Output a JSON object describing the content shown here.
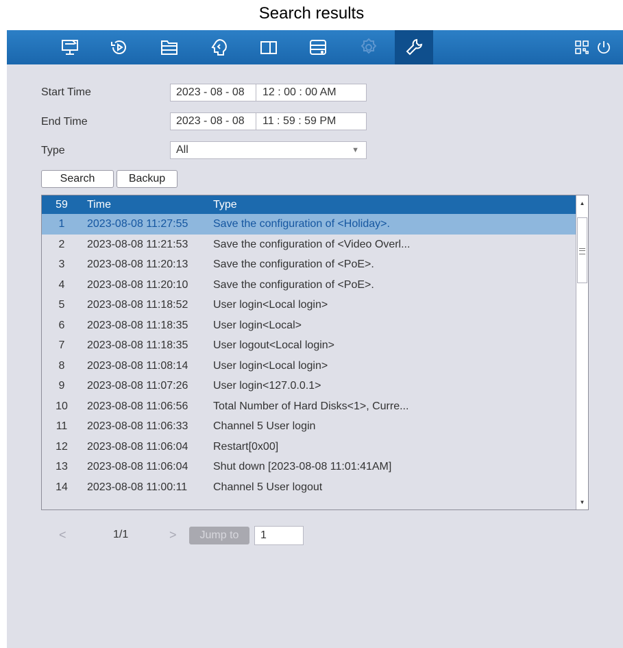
{
  "caption": "Search results",
  "nav": {
    "icons": [
      "live-view",
      "playback",
      "file-management",
      "smart-analytics",
      "camera",
      "storage",
      "settings",
      "maintenance"
    ],
    "active": "maintenance",
    "right_icons": [
      "qr-code",
      "power"
    ]
  },
  "form": {
    "start_time_label": "Start Time",
    "start_date": "2023 - 08 - 08",
    "start_time": "12 : 00 : 00  AM",
    "end_time_label": "End Time",
    "end_date": "2023 - 08 - 08",
    "end_time": "11 : 59 : 59  PM",
    "type_label": "Type",
    "type_value": "All"
  },
  "buttons": {
    "search": "Search",
    "backup": "Backup"
  },
  "table": {
    "count": "59",
    "col_time": "Time",
    "col_type": "Type",
    "rows": [
      {
        "n": "1",
        "time": "2023-08-08 11:27:55",
        "type": "Save the configuration of <Holiday>."
      },
      {
        "n": "2",
        "time": "2023-08-08 11:21:53",
        "type": "Save the configuration of <Video Overl..."
      },
      {
        "n": "3",
        "time": "2023-08-08 11:20:13",
        "type": "Save the configuration of <PoE>."
      },
      {
        "n": "4",
        "time": "2023-08-08 11:20:10",
        "type": "Save the configuration of <PoE>."
      },
      {
        "n": "5",
        "time": "2023-08-08 11:18:52",
        "type": "User login<Local login>"
      },
      {
        "n": "6",
        "time": "2023-08-08 11:18:35",
        "type": "User login<Local>"
      },
      {
        "n": "7",
        "time": "2023-08-08 11:18:35",
        "type": "User logout<Local login>"
      },
      {
        "n": "8",
        "time": "2023-08-08 11:08:14",
        "type": "User login<Local login>"
      },
      {
        "n": "9",
        "time": "2023-08-08 11:07:26",
        "type": "User login<127.0.0.1>"
      },
      {
        "n": "10",
        "time": "2023-08-08 11:06:56",
        "type": "Total Number of Hard Disks<1>, Curre..."
      },
      {
        "n": "11",
        "time": "2023-08-08 11:06:33",
        "type": "Channel 5 User login"
      },
      {
        "n": "12",
        "time": "2023-08-08 11:06:04",
        "type": "Restart[0x00]"
      },
      {
        "n": "13",
        "time": "2023-08-08 11:06:04",
        "type": "Shut down [2023-08-08 11:01:41AM]"
      },
      {
        "n": "14",
        "time": "2023-08-08 11:00:11",
        "type": "Channel 5 User logout"
      }
    ]
  },
  "pager": {
    "prev": "<",
    "page": "1/1",
    "next": ">",
    "jump_label": "Jump to",
    "jump_value": "1"
  },
  "colors": {
    "topbar": "#1a67ad",
    "active_tab": "#0f4f8d",
    "header": "#1c6aae",
    "selected_row": "#8eb7dd",
    "background": "#dfe0e8"
  }
}
